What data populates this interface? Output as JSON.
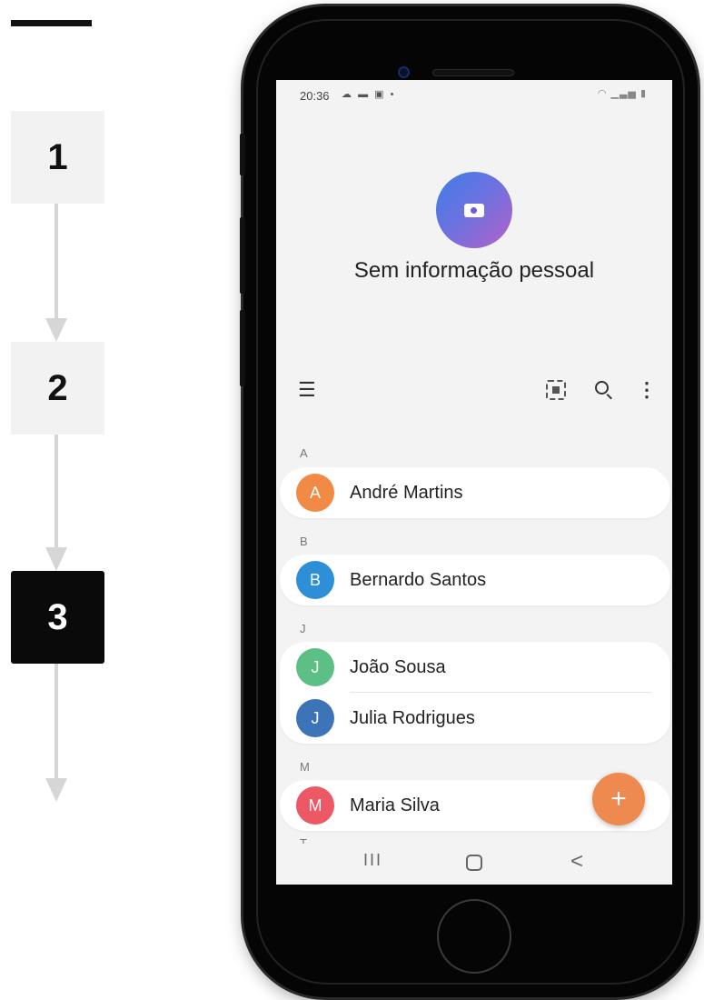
{
  "steps": [
    {
      "label": "1",
      "active": false
    },
    {
      "label": "2",
      "active": false
    },
    {
      "label": "3",
      "active": true
    }
  ],
  "status_bar": {
    "time": "20:36",
    "left_icons": [
      "cloud-icon",
      "message-icon",
      "image-icon",
      "dot-icon"
    ],
    "right_icons": [
      "wifi-icon",
      "signal-icon",
      "battery-icon"
    ]
  },
  "profile": {
    "avatar_icon": "camera-icon",
    "text": "Sem informação pessoal"
  },
  "toolbar": {
    "icons": [
      "menu-icon",
      "qr-code-icon",
      "search-icon",
      "more-icon"
    ]
  },
  "sections": [
    {
      "letter": "A",
      "contacts": [
        {
          "initial": "A",
          "first": "André",
          "last": "Martins",
          "color": "#f08a45"
        }
      ]
    },
    {
      "letter": "B",
      "contacts": [
        {
          "initial": "B",
          "first": "Bernardo",
          "last": "Santos",
          "color": "#2c8fd8"
        }
      ]
    },
    {
      "letter": "J",
      "contacts": [
        {
          "initial": "J",
          "first": "João",
          "last": "Sousa",
          "color": "#5cbf86"
        },
        {
          "initial": "J",
          "first": "Julia",
          "last": "Rodrigues",
          "color": "#3d74b8"
        }
      ]
    },
    {
      "letter": "M",
      "contacts": [
        {
          "initial": "M",
          "first": "Maria",
          "last": "Silva",
          "color": "#ec5864"
        }
      ]
    },
    {
      "letter": "T",
      "contacts": []
    }
  ],
  "fab": {
    "label": "+",
    "color": "#ee8a4f"
  },
  "nav_bar": {
    "recents": "III",
    "back": "<"
  }
}
